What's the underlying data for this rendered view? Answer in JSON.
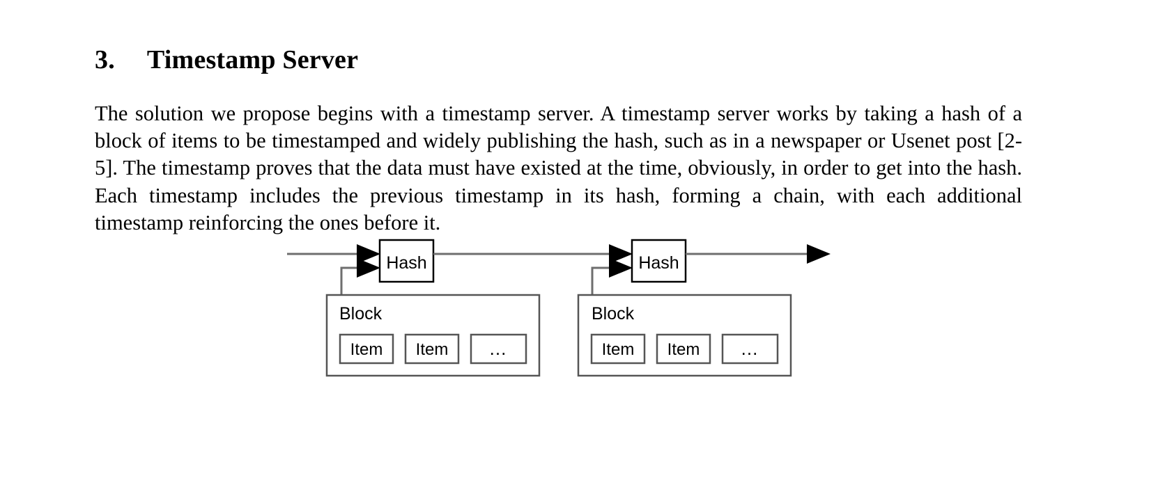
{
  "document": {
    "section_number": "3.",
    "section_title": "Timestamp Server",
    "paragraph": "The solution we propose begins with a timestamp server.  A timestamp server works by taking a hash of a block of items to be timestamped and widely publishing the hash, such as in a newspaper or Usenet post [2-5].  The timestamp proves that the data must have existed at the time, obviously, in order to get into the hash.  Each timestamp includes the previous timestamp in its hash, forming a chain, with each additional timestamp reinforcing the ones before it."
  },
  "diagram": {
    "name": "timestamp-server-chain-diagram",
    "nodes": {
      "hash_left": "Hash",
      "hash_right": "Hash",
      "block_left": "Block",
      "block_right": "Block"
    },
    "block_left_items": [
      "Item",
      "Item",
      "..."
    ],
    "block_right_items": [
      "Item",
      "Item",
      "..."
    ],
    "colors": {
      "stroke": "#000000",
      "line": "#6e6e6e",
      "box_border": "#555555",
      "background": "#ffffff",
      "text": "#000000"
    }
  }
}
